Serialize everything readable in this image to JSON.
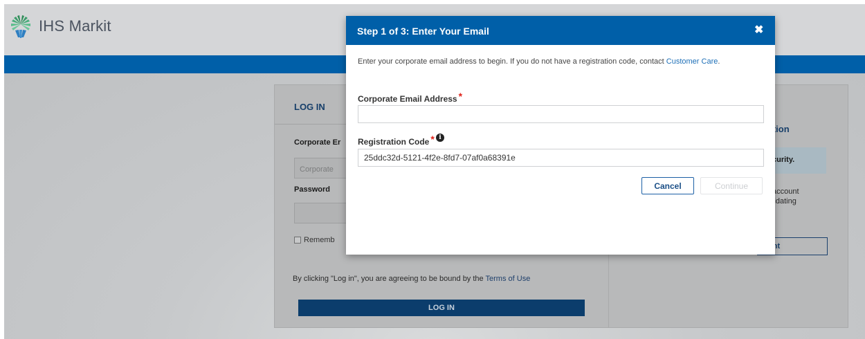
{
  "header": {
    "brand_name": "IHS Markit",
    "logo_icon": "ihs-markit-logo-icon",
    "brand_color": "#005fa8"
  },
  "login_card": {
    "title": "LOG IN",
    "email_label": "Corporate Er",
    "email_placeholder": "Corporate",
    "password_label": "Password",
    "remember_label": "Rememb",
    "agreement_text": "By clicking \"Log in\", you are agreeing to be bound by the ",
    "terms_link": "Terms of Use",
    "login_button": "LOG IN"
  },
  "right_card": {
    "heading": "lation",
    "security_text": "curity.",
    "line1": "account",
    "line2": "lidating",
    "button": "unt"
  },
  "modal": {
    "title": "Step 1 of 3: Enter Your Email",
    "close_icon": "close-icon",
    "intro_text": "Enter your corporate email address to begin. If you do not have a registration code, contact ",
    "intro_link": "Customer Care",
    "intro_end": ".",
    "email_label": "Corporate Email Address",
    "required_mark": "*",
    "email_value": "",
    "code_label": "Registration Code",
    "info_icon": "info-icon",
    "code_value": "25ddc32d-5121-4f2e-8fd7-07af0a68391e",
    "cancel_button": "Cancel",
    "continue_button": "Continue"
  }
}
